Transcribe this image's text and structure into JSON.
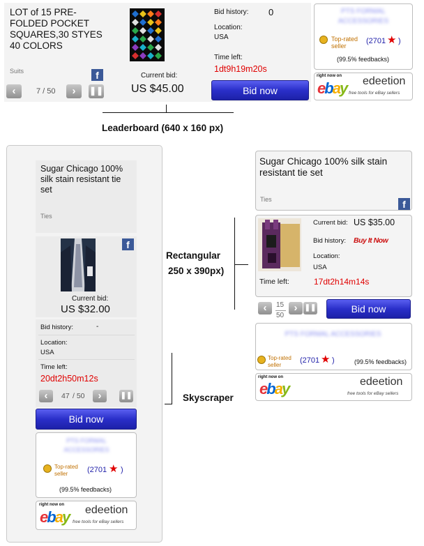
{
  "leaderboard": {
    "title": "LOT of 15 PRE-FOLDED POCKET SQUARES,30 STYES 40 COLORS",
    "category": "Suits",
    "pager": "7 / 50",
    "current_bid_label": "Current bid:",
    "current_bid": "US $45.00",
    "bid_history_label": "Bid history:",
    "bid_history": "0",
    "location_label": "Location:",
    "location": "USA",
    "time_left_label": "Time left:",
    "time_left": "1dt9h19m20s",
    "bid_button": "Bid now",
    "seller_name": "PTS FORMAL ACCESSORIES",
    "top_rated": "Top-rated seller",
    "feedback_count": "(2701",
    "feedback_close": ")",
    "feedback_pct": "(99.5% feedbacks)"
  },
  "leaderboard_caption": "Leaderboard (640 x 160 px)",
  "skyscraper": {
    "title": "Sugar Chicago 100% silk stain resistant tie set",
    "category": "Ties",
    "current_bid_label": "Current bid:",
    "current_bid": "US $32.00",
    "bid_history_label": "Bid history:",
    "bid_history": "-",
    "location_label": "Location:",
    "location": "USA",
    "time_left_label": "Time left:",
    "time_left": "20dt2h50m12s",
    "pager_current": "47",
    "pager_total": "/ 50",
    "bid_button": "Bid now",
    "seller_name": "PTS FORMAL ACCESSORIES",
    "top_rated": "Top-rated seller",
    "feedback_count": "(2701",
    "feedback_close": ")",
    "feedback_pct": "(99.5% feedbacks)"
  },
  "skyscraper_caption": "Skyscraper",
  "rectangular": {
    "title": "Sugar Chicago 100% silk stain resistant tie set",
    "category": "Ties",
    "current_bid_label": "Current bid:",
    "current_bid": "US $35.00",
    "bid_history_label": "Bid history:",
    "buy_it_now": "Buy It Now",
    "location_label": "Location:",
    "location": "USA",
    "time_left_label": "Time left:",
    "time_left": "17dt2h14m14s",
    "pager_current": "15",
    "pager_total": "50",
    "bid_button": "Bid now",
    "seller_name": "PTS FORMAL ACCESSORIES",
    "top_rated": "Top-rated seller",
    "feedback_count": "(2701",
    "feedback_close": ")",
    "feedback_pct": "(99.5% feedbacks)"
  },
  "rectangular_caption_1": "Rectangular",
  "rectangular_caption_2": "250 x 390px)",
  "ebay_promo": {
    "right_now_on": "right now on",
    "brand": "edeetion",
    "tagline": "free tools for eBay sellers",
    "ebay_e": "e",
    "ebay_b": "b",
    "ebay_a": "a",
    "ebay_y": "y"
  },
  "colors": {
    "accent_blue": "#2a2fc9",
    "time_red": "#e00000",
    "facebook": "#3b5998"
  }
}
